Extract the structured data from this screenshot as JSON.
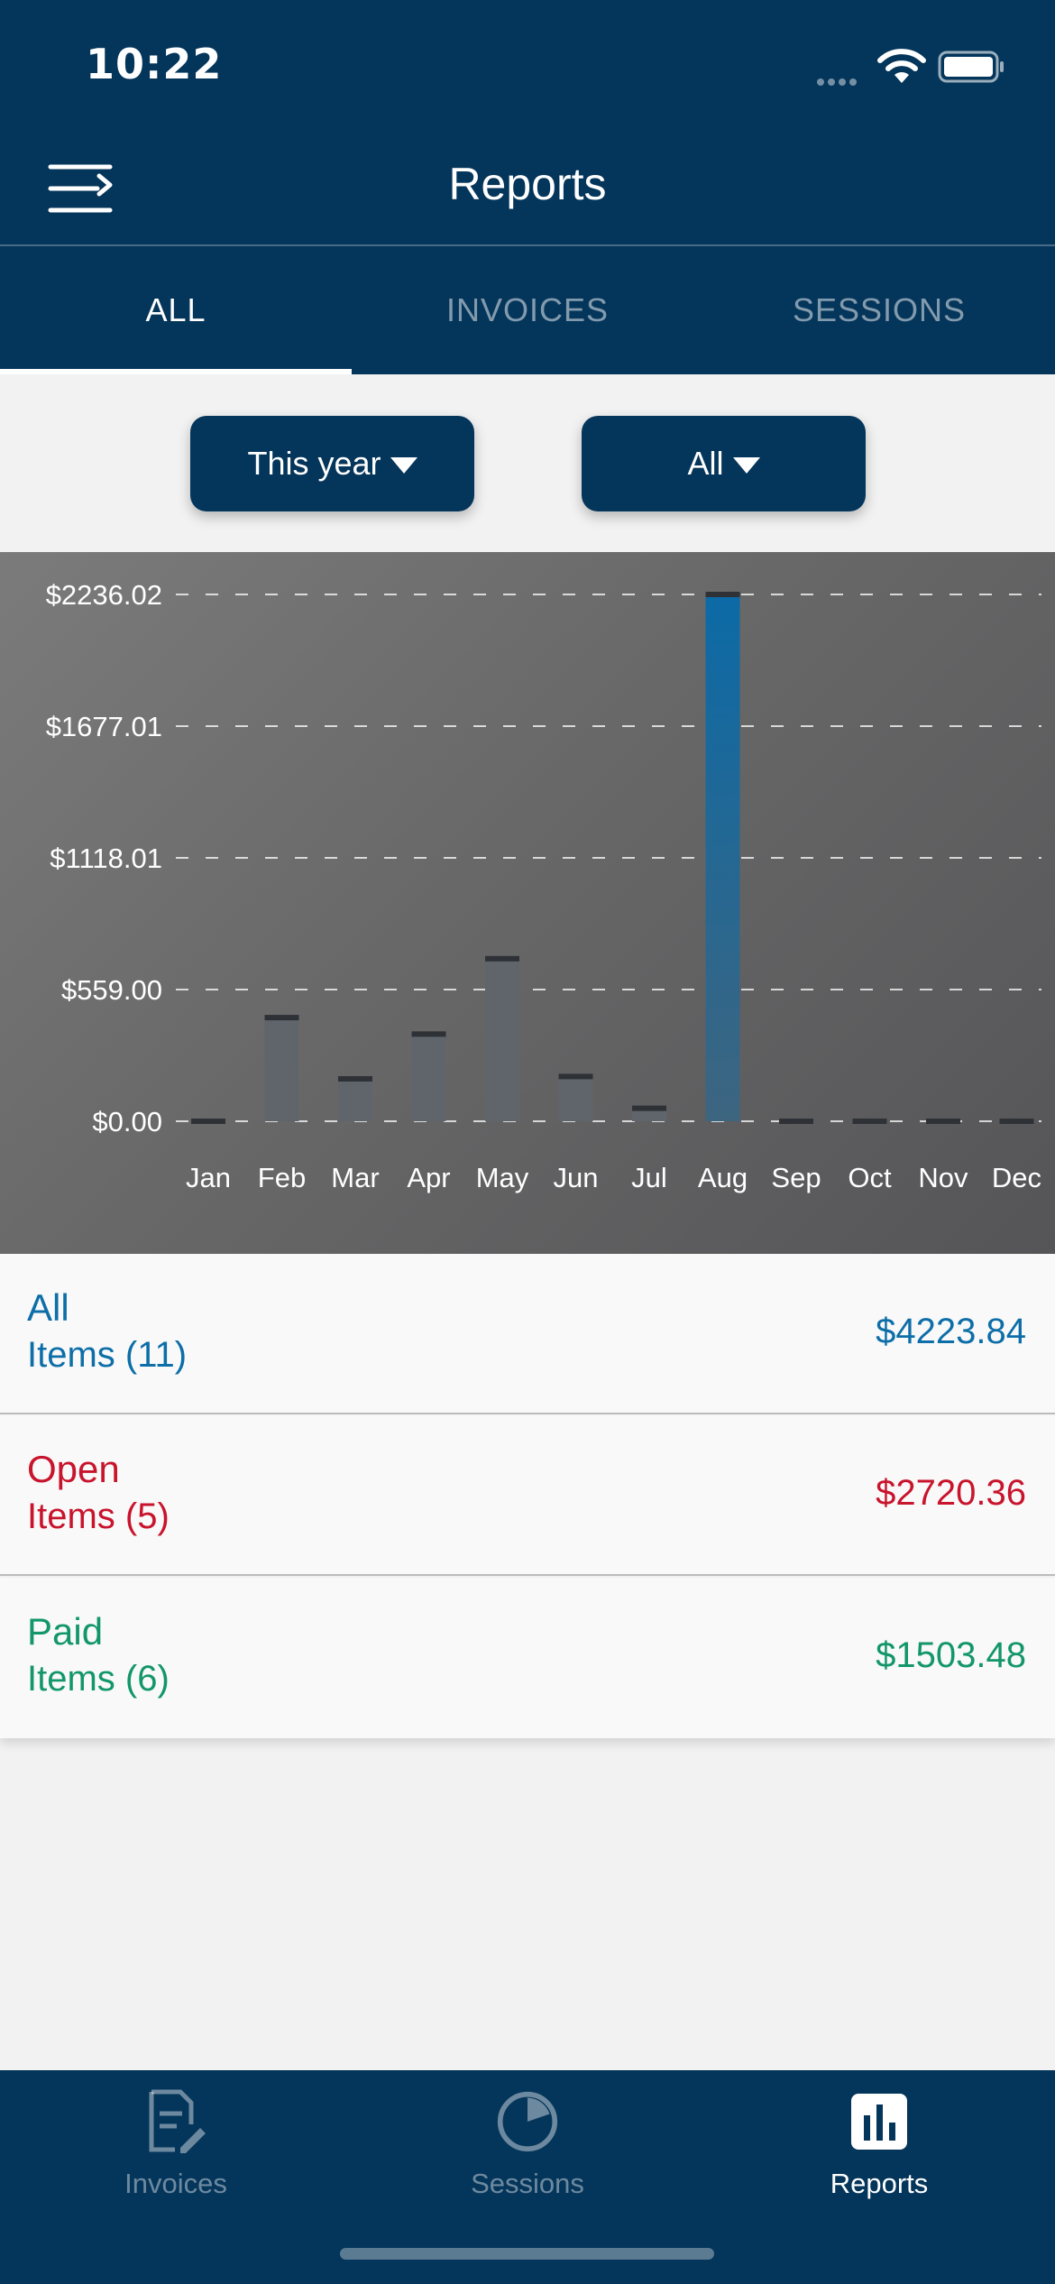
{
  "status_bar": {
    "time": "10:22"
  },
  "header": {
    "title": "Reports"
  },
  "tabs": [
    {
      "label": "ALL",
      "active": true
    },
    {
      "label": "INVOICES",
      "active": false
    },
    {
      "label": "SESSIONS",
      "active": false
    }
  ],
  "filters": {
    "period": "This year",
    "type": "All"
  },
  "chart_data": {
    "type": "bar",
    "categories": [
      "Jan",
      "Feb",
      "Mar",
      "Apr",
      "May",
      "Jun",
      "Jul",
      "Aug",
      "Sep",
      "Oct",
      "Nov",
      "Dec"
    ],
    "values": [
      0,
      440,
      180,
      370,
      690,
      190,
      55,
      2236.02,
      0,
      0,
      0,
      0
    ],
    "highlight_index": 7,
    "y_ticks": [
      "$0.00",
      "$559.00",
      "$1118.01",
      "$1677.01",
      "$2236.02"
    ],
    "ylim": [
      0,
      2236.02
    ],
    "grid": true
  },
  "summary": [
    {
      "title": "All",
      "subtitle": "Items (11)",
      "amount": "$4223.84",
      "color": "#0d6ea8"
    },
    {
      "title": "Open",
      "subtitle": "Items (5)",
      "amount": "$2720.36",
      "color": "#c8142c"
    },
    {
      "title": "Paid",
      "subtitle": "Items (6)",
      "amount": "$1503.48",
      "color": "#12966a"
    }
  ],
  "tabbar": [
    {
      "label": "Invoices",
      "icon": "invoice-edit-icon",
      "active": false
    },
    {
      "label": "Sessions",
      "icon": "pie-chart-icon",
      "active": false
    },
    {
      "label": "Reports",
      "icon": "bar-chart-icon",
      "active": true
    }
  ]
}
